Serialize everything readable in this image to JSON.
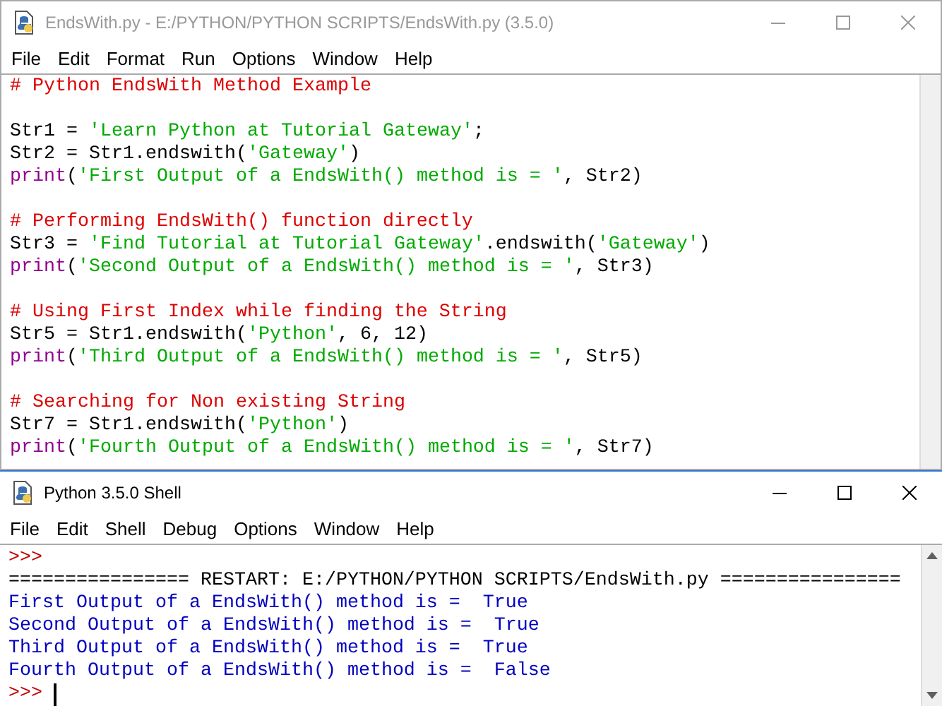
{
  "editor": {
    "title": "EndsWith.py - E:/PYTHON/PYTHON SCRIPTS/EndsWith.py (3.5.0)",
    "active": false,
    "menu": [
      "File",
      "Edit",
      "Format",
      "Run",
      "Options",
      "Window",
      "Help"
    ],
    "blocks": [
      [
        [
          {
            "kind": "comment",
            "text": "# Python EndsWith Method Example"
          }
        ]
      ],
      [
        [
          {
            "kind": "plain",
            "text": "Str1 = "
          },
          {
            "kind": "string",
            "text": "'Learn Python at Tutorial Gateway'"
          },
          {
            "kind": "plain",
            "text": ";"
          }
        ],
        [
          {
            "kind": "plain",
            "text": "Str2 = Str1.endswith("
          },
          {
            "kind": "string",
            "text": "'Gateway'"
          },
          {
            "kind": "plain",
            "text": ")"
          }
        ],
        [
          {
            "kind": "builtin",
            "text": "print"
          },
          {
            "kind": "plain",
            "text": "("
          },
          {
            "kind": "string",
            "text": "'First Output of a EndsWith() method is = '"
          },
          {
            "kind": "plain",
            "text": ", Str2)"
          }
        ]
      ],
      [
        [
          {
            "kind": "comment",
            "text": "# Performing EndsWith() function directly"
          }
        ],
        [
          {
            "kind": "plain",
            "text": "Str3 = "
          },
          {
            "kind": "string",
            "text": "'Find Tutorial at Tutorial Gateway'"
          },
          {
            "kind": "plain",
            "text": ".endswith("
          },
          {
            "kind": "string",
            "text": "'Gateway'"
          },
          {
            "kind": "plain",
            "text": ")"
          }
        ],
        [
          {
            "kind": "builtin",
            "text": "print"
          },
          {
            "kind": "plain",
            "text": "("
          },
          {
            "kind": "string",
            "text": "'Second Output of a EndsWith() method is = '"
          },
          {
            "kind": "plain",
            "text": ", Str3)"
          }
        ]
      ],
      [
        [
          {
            "kind": "comment",
            "text": "# Using First Index while finding the String"
          }
        ],
        [
          {
            "kind": "plain",
            "text": "Str5 = Str1.endswith("
          },
          {
            "kind": "string",
            "text": "'Python'"
          },
          {
            "kind": "plain",
            "text": ", 6, 12)"
          }
        ],
        [
          {
            "kind": "builtin",
            "text": "print"
          },
          {
            "kind": "plain",
            "text": "("
          },
          {
            "kind": "string",
            "text": "'Third Output of a EndsWith() method is = '"
          },
          {
            "kind": "plain",
            "text": ", Str5)"
          }
        ]
      ],
      [
        [
          {
            "kind": "comment",
            "text": "# Searching for Non existing String"
          }
        ],
        [
          {
            "kind": "plain",
            "text": "Str7 = Str1.endswith("
          },
          {
            "kind": "string",
            "text": "'Python'"
          },
          {
            "kind": "plain",
            "text": ")"
          }
        ],
        [
          {
            "kind": "builtin",
            "text": "print"
          },
          {
            "kind": "plain",
            "text": "("
          },
          {
            "kind": "string",
            "text": "'Fourth Output of a EndsWith() method is = '"
          },
          {
            "kind": "plain",
            "text": ", Str7)"
          }
        ]
      ]
    ]
  },
  "shell": {
    "title": "Python 3.5.0 Shell",
    "active": true,
    "menu": [
      "File",
      "Edit",
      "Shell",
      "Debug",
      "Options",
      "Window",
      "Help"
    ],
    "lines": [
      {
        "kind": "prompt",
        "text": ">>>"
      },
      {
        "kind": "plain",
        "text": "================ RESTART: E:/PYTHON/PYTHON SCRIPTS/EndsWith.py ================"
      },
      {
        "kind": "output",
        "text": "First Output of a EndsWith() method is =  True"
      },
      {
        "kind": "output",
        "text": "Second Output of a EndsWith() method is =  True"
      },
      {
        "kind": "output",
        "text": "Third Output of a EndsWith() method is =  True"
      },
      {
        "kind": "output",
        "text": "Fourth Output of a EndsWith() method is =  False"
      },
      {
        "kind": "prompt",
        "text": ">>>"
      }
    ]
  }
}
